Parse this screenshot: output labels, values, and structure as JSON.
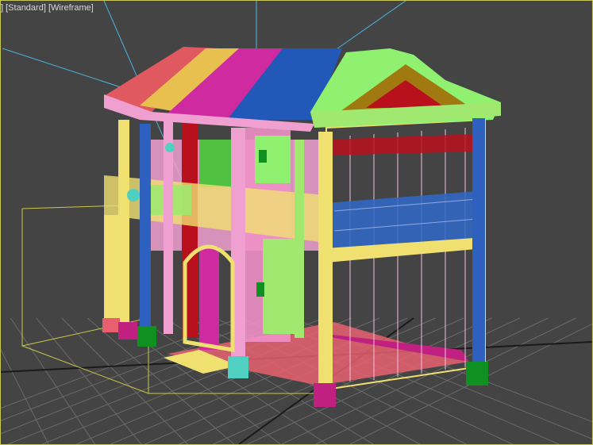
{
  "viewport": {
    "labels": {
      "view_fragment": "]",
      "shading_standard": "[Standard]",
      "shading_wireframe": "[Wireframe]"
    },
    "colors": {
      "background": "#444444",
      "grid": "#6a6a6a",
      "grid_axis": "#1a1a1a",
      "viewport_border": "#c8c85a",
      "light_lines": "#4ab4e0",
      "bounding_box": "#c8c84a"
    }
  },
  "model": {
    "colors": {
      "roof_red": "#e05860",
      "roof_yellow": "#e8c050",
      "roof_magenta": "#d02aa0",
      "roof_blue": "#2258b8",
      "roof_green": "#90f070",
      "post_yellow": "#f0e070",
      "post_blue": "#2e60c0",
      "post_pink": "#f0a0d0",
      "post_green": "#a0e870",
      "wall_red": "#b8101c",
      "wall_pink": "#f090c8",
      "base_magenta": "#c02080",
      "base_green": "#109020",
      "base_salmon": "#e86070",
      "base_cyan": "#50d0c0",
      "railing_blue": "#3068c8",
      "gable_olive": "#a07a10"
    }
  }
}
